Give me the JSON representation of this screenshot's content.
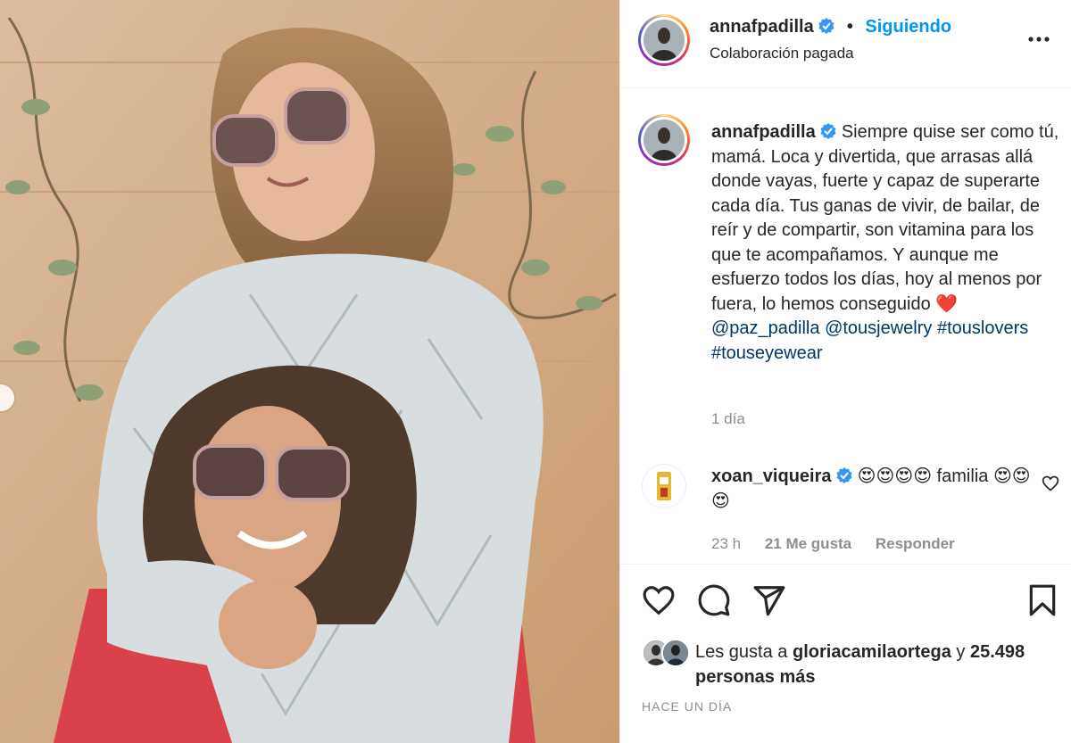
{
  "header": {
    "username": "annafpadilla",
    "separator": "•",
    "follow_status": "Siguiendo",
    "subtitle": "Colaboración pagada"
  },
  "caption": {
    "username": "annafpadilla",
    "text": "Siempre quise ser como tú, mamá. Loca y divertida, que arrasas allá donde vayas, fuerte y capaz de superarte cada día. Tus ganas de vivir, de bailar, de reír y de compartir, son vitamina para los que te acompañamos. Y aunque me esfuerzo todos los días, hoy al menos por fuera, lo hemos conseguido",
    "heart": "❤️",
    "mention": "@paz_padilla",
    "tags": [
      "@tousjewelry",
      "#touslovers",
      "#touseyewear"
    ],
    "time": "1 día"
  },
  "comment": {
    "username": "xoan_viqueira",
    "text": "😍😍😍😍 familia 😍😍😍",
    "time": "23 h",
    "likes": "21 Me gusta",
    "reply": "Responder"
  },
  "likes": {
    "prefix": "Les gusta a",
    "user": "gloriacamilaortega",
    "connector": "y",
    "others": "25.498 personas más"
  },
  "posted": "HACE UN DÍA",
  "icons": {
    "verified": "verified-badge-icon",
    "more": "more-options-icon",
    "like": "heart-icon",
    "comment": "comment-icon",
    "share": "share-icon",
    "save": "bookmark-icon"
  },
  "colors": {
    "accent": "#0095f6",
    "hashtag": "#00376b",
    "muted": "#8e8e8e",
    "text": "#262626"
  }
}
